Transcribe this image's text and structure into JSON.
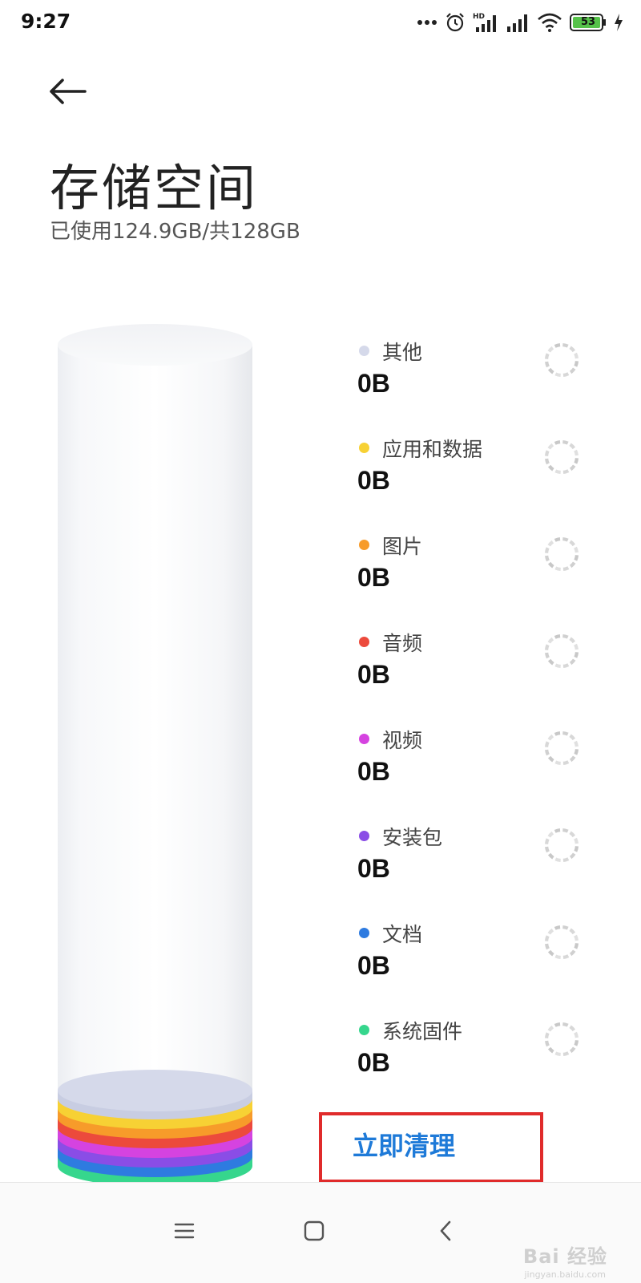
{
  "status_bar": {
    "time": "9:27",
    "battery": "53",
    "icons": [
      "more-dots-icon",
      "alarm-icon",
      "hd-signal-icon",
      "signal-icon",
      "wifi-icon",
      "battery-icon",
      "charging-icon"
    ]
  },
  "header": {
    "title": "存储空间",
    "summary": "已使用124.9GB/共128GB"
  },
  "storage": {
    "used_gb": 124.9,
    "total_gb": 128,
    "categories": [
      {
        "label": "其他",
        "value": "0B",
        "color": "#d5d9ea"
      },
      {
        "label": "应用和数据",
        "value": "0B",
        "color": "#f7d134"
      },
      {
        "label": "图片",
        "value": "0B",
        "color": "#f79b2a"
      },
      {
        "label": "音频",
        "value": "0B",
        "color": "#ec4a3c"
      },
      {
        "label": "视频",
        "value": "0B",
        "color": "#d543e0"
      },
      {
        "label": "安装包",
        "value": "0B",
        "color": "#8a4de6"
      },
      {
        "label": "文档",
        "value": "0B",
        "color": "#2e7be0"
      },
      {
        "label": "系统固件",
        "value": "0B",
        "color": "#36d68d"
      }
    ]
  },
  "actions": {
    "clean_label": "立即清理",
    "clean_color": "#1e7ad8"
  },
  "nav_bar": {
    "buttons": [
      "menu-icon",
      "home-icon",
      "back-icon"
    ]
  },
  "watermark": {
    "text": "Bai 经验",
    "sub": "jingyan.baidu.com"
  }
}
